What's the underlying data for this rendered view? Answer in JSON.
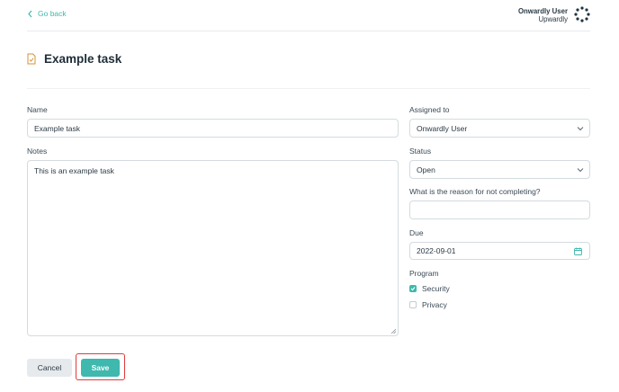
{
  "header": {
    "back_label": "Go back",
    "user_name": "Onwardly User",
    "org_name": "Upwardly"
  },
  "page": {
    "title": "Example task"
  },
  "form": {
    "name": {
      "label": "Name",
      "value": "Example task"
    },
    "notes": {
      "label": "Notes",
      "value": "This is an example task"
    },
    "assigned_to": {
      "label": "Assigned to",
      "value": "Onwardly User"
    },
    "status": {
      "label": "Status",
      "value": "Open"
    },
    "reason": {
      "label": "What is the reason for not completing?",
      "value": ""
    },
    "due": {
      "label": "Due",
      "value": "2022-09-01"
    },
    "program": {
      "label": "Program",
      "options": [
        {
          "label": "Security",
          "checked": true
        },
        {
          "label": "Privacy",
          "checked": false
        }
      ]
    }
  },
  "actions": {
    "cancel_label": "Cancel",
    "save_label": "Save"
  },
  "colors": {
    "accent": "#3fb8ad",
    "highlight": "#e03b3b"
  }
}
